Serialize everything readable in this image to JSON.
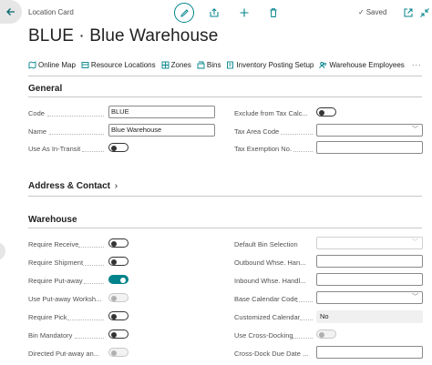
{
  "header": {
    "breadcrumb": "Location Card",
    "saved_label": "Saved",
    "title": "BLUE · Blue Warehouse"
  },
  "actions": [
    {
      "label": "Online Map",
      "icon": "map-icon"
    },
    {
      "label": "Resource Locations",
      "icon": "resource-icon"
    },
    {
      "label": "Zones",
      "icon": "zones-icon"
    },
    {
      "label": "Bins",
      "icon": "bins-icon"
    },
    {
      "label": "Inventory Posting Setup",
      "icon": "posting-setup-icon"
    },
    {
      "label": "Warehouse Employees",
      "icon": "employees-icon"
    }
  ],
  "general": {
    "title": "General",
    "code_label": "Code",
    "code_value": "BLUE",
    "name_label": "Name",
    "name_value": "Blue Warehouse",
    "in_transit_label": "Use As In-Transit",
    "exclude_tax_label": "Exclude from Tax Calc...",
    "tax_area_label": "Tax Area Code",
    "tax_exemption_label": "Tax Exemption No."
  },
  "address": {
    "title": "Address & Contact"
  },
  "warehouse": {
    "title": "Warehouse",
    "left": [
      {
        "label": "Require Receive",
        "state": "off"
      },
      {
        "label": "Require Shipment",
        "state": "off"
      },
      {
        "label": "Require Put-away",
        "state": "on"
      },
      {
        "label": "Use Put-away Worksh...",
        "state": "disabled"
      },
      {
        "label": "Require Pick",
        "state": "off"
      },
      {
        "label": "Bin Mandatory",
        "state": "off"
      },
      {
        "label": "Directed Put-away an...",
        "state": "disabled"
      }
    ],
    "default_bin_label": "Default Bin Selection",
    "outbound_label": "Outbound Whse. Han...",
    "inbound_label": "Inbound Whse. Handl...",
    "base_calendar_label": "Base Calendar Code",
    "customized_calendar_label": "Customized Calendar",
    "customized_calendar_value": "No",
    "cross_docking_label": "Use Cross-Docking",
    "cross_dock_due_label": "Cross-Dock Due Date ..."
  },
  "colors": {
    "accent": "#00838a",
    "text": "#212121",
    "muted": "#505050"
  }
}
